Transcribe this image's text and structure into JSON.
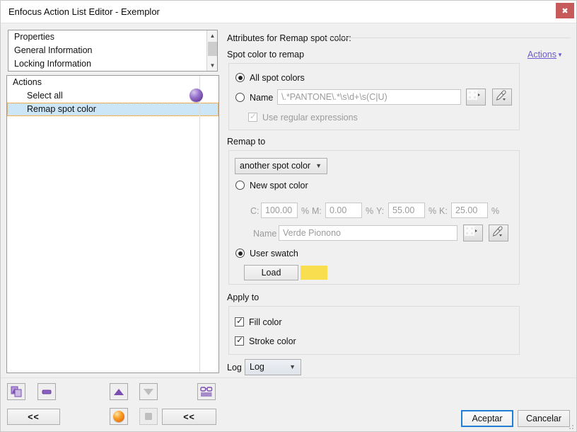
{
  "window": {
    "title": "Enfocus Action List Editor - Exemplor",
    "close_label": "✖"
  },
  "properties_list": {
    "items": [
      {
        "label": "Properties"
      },
      {
        "label": "General Information"
      },
      {
        "label": "Locking Information"
      }
    ]
  },
  "actions_list": {
    "header": "Actions",
    "items": [
      {
        "label": "Select all",
        "selected": false
      },
      {
        "label": "Remap spot color",
        "selected": true
      }
    ]
  },
  "attributes": {
    "title": "Attributes for Remap spot color:",
    "actions_link": "Actions",
    "actions_caret": "▼"
  },
  "spot_to_remap": {
    "group_label": "Spot color to remap",
    "all_spot_colors_label": "All spot colors",
    "name_label": "Name",
    "name_value": "\\.*PANTONE\\.*\\s\\d+\\s(C|U)",
    "use_regex_label": "Use regular expressions"
  },
  "remap_to": {
    "group_label": "Remap to",
    "mode_value": "another spot color",
    "mode_caret": "⌄",
    "new_spot_color_label": "New spot color",
    "cmyk": [
      {
        "label": "C:",
        "value": "100.00",
        "unit": "%"
      },
      {
        "label": "M:",
        "value": "0.00",
        "unit": "%"
      },
      {
        "label": "Y:",
        "value": "55.00",
        "unit": "%"
      },
      {
        "label": "K:",
        "value": "25.00",
        "unit": "%"
      }
    ],
    "name_label": "Name",
    "name_value": "Verde Pionono",
    "user_swatch_label": "User swatch",
    "load_label": "Load",
    "swatch_color": "#f9df50"
  },
  "apply_to": {
    "group_label": "Apply to",
    "fill_label": "Fill color",
    "stroke_label": "Stroke color"
  },
  "log": {
    "label": "Log",
    "value": "Log",
    "caret": "⌄"
  },
  "toolbar": {
    "collapse_left_label": "<<",
    "collapse_right_label": "<<"
  },
  "footer": {
    "ok_label": "Aceptar",
    "cancel_label": "Cancelar"
  },
  "colors": {
    "accent_purple": "#7a4fb0",
    "selection_blue": "#cde6f7",
    "focus_orange": "#e08b2a",
    "link_purple": "#6a5acd",
    "default_button_blue": "#1f7fd4",
    "close_red": "#c75b5b",
    "swatch_yellow": "#f9df50"
  }
}
